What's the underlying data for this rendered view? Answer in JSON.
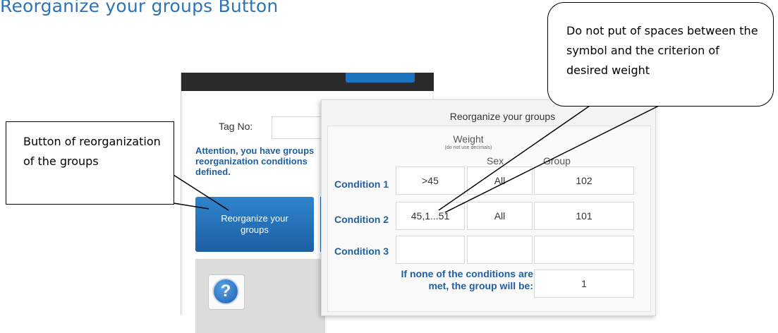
{
  "doc_title": "Reorganize your groups Button",
  "app": {
    "tag_label": "Tag No:",
    "tag_value": "",
    "attention": "Attention, you have groups reorganization conditions defined.",
    "reorganize_button": "Reorganize your groups",
    "help_icon": "?"
  },
  "popup": {
    "title": "Reorganize your groups",
    "headers": {
      "weight": "Weight",
      "weight_note": "(do not use decimals)",
      "sex": "Sex",
      "group": "Group"
    },
    "conditions": [
      {
        "label": "Condition 1",
        "weight": ">45",
        "sex": "All",
        "group": "102"
      },
      {
        "label": "Condition 2",
        "weight": "45,1...51",
        "sex": "All",
        "group": "101"
      },
      {
        "label": "Condition 3",
        "weight": "",
        "sex": "",
        "group": ""
      }
    ],
    "none_text": "If none of the conditions are met, the group will be:",
    "default_group": "1"
  },
  "callouts": {
    "left": "Button of reorganization of the groups",
    "right": "Do not put of spaces between the symbol and the criterion of desired weight"
  },
  "colors": {
    "title": "#2e74b5",
    "accent_blue": "#1e73be",
    "label_blue": "#1f5f9f"
  }
}
